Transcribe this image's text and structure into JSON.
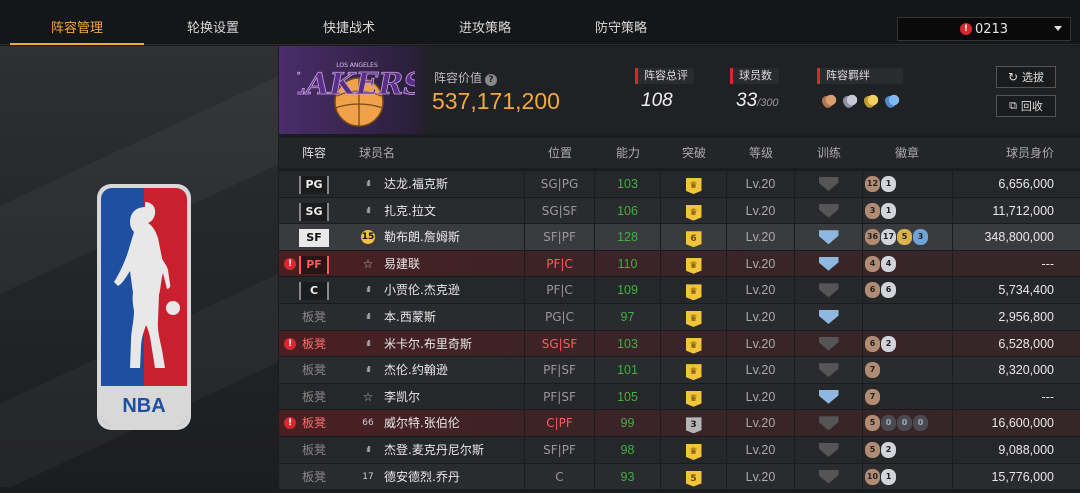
{
  "tabs": [
    {
      "label": "阵容管理",
      "active": true
    },
    {
      "label": "轮换设置",
      "active": false
    },
    {
      "label": "快捷战术",
      "active": false
    },
    {
      "label": "进攻策略",
      "active": false
    },
    {
      "label": "防守策略",
      "active": false
    }
  ],
  "roster_select": {
    "value": "0213",
    "warn_glyph": "!"
  },
  "logo": {
    "text": "NBA"
  },
  "team": {
    "name": "LAKERS",
    "city": "LOS ANGELES"
  },
  "lineup_value": {
    "label": "阵容价值",
    "help": "?",
    "value": "537,171,200"
  },
  "stats": {
    "rating": {
      "label": "阵容总评",
      "value": "108"
    },
    "players": {
      "label": "球员数",
      "value": "33",
      "max": "/300"
    },
    "bonds": {
      "label": "阵容羁绊",
      "icons": [
        "bond-bronze-icon",
        "bond-silver-icon",
        "bond-gold-icon",
        "bond-blue-icon"
      ]
    }
  },
  "buttons": {
    "select": "选拔",
    "recycle": "回收"
  },
  "columns": {
    "slot": "阵容",
    "name": "球员名",
    "position": "位置",
    "ability": "能力",
    "breakthrough": "突破",
    "level": "等级",
    "training": "训练",
    "badges": "徽章",
    "price": "球员身价"
  },
  "rows": [
    {
      "slot": "PG",
      "slot_type": "starter",
      "warn": false,
      "icon": "bars",
      "icon_text": "ıll",
      "name": "达龙.福克斯",
      "position": "SG|PG",
      "pos_warn": false,
      "ability": "103",
      "break": "♛",
      "break_grey": false,
      "level": "Lv.20",
      "train_blue": false,
      "badges": [
        [
          "12",
          "bronze"
        ],
        [
          "1",
          "silver"
        ]
      ],
      "price": "6,656,000",
      "selected": false
    },
    {
      "slot": "SG",
      "slot_type": "starter",
      "warn": false,
      "icon": "bars",
      "icon_text": "ıll",
      "name": "扎克.拉文",
      "position": "SG|SF",
      "pos_warn": false,
      "ability": "106",
      "break": "♛",
      "break_grey": false,
      "level": "Lv.20",
      "train_blue": false,
      "badges": [
        [
          "3",
          "bronze"
        ],
        [
          "1",
          "silver"
        ]
      ],
      "price": "11,712,000",
      "selected": false
    },
    {
      "slot": "SF",
      "slot_type": "selected",
      "warn": false,
      "icon": "n15",
      "icon_text": "15",
      "name": "勒布朗.詹姆斯",
      "position": "SF|PF",
      "pos_warn": false,
      "ability": "128",
      "break": "6",
      "break_grey": false,
      "level": "Lv.20",
      "train_blue": true,
      "badges": [
        [
          "36",
          "bronze"
        ],
        [
          "17",
          "silver"
        ],
        [
          "5",
          "gold"
        ],
        [
          "3",
          "blue"
        ]
      ],
      "price": "348,800,000",
      "selected": true
    },
    {
      "slot": "PF",
      "slot_type": "error",
      "warn": true,
      "icon": "star",
      "icon_text": "☆",
      "name": "易建联",
      "position": "PF|C",
      "pos_warn": true,
      "ability": "110",
      "break": "♛",
      "break_grey": false,
      "level": "Lv.20",
      "train_blue": true,
      "badges": [
        [
          "4",
          "bronze"
        ],
        [
          "4",
          "silver"
        ]
      ],
      "price": "---",
      "selected": false
    },
    {
      "slot": "C",
      "slot_type": "starter",
      "warn": false,
      "icon": "bars",
      "icon_text": "ıll",
      "name": "小贾伦.杰克逊",
      "position": "PF|C",
      "pos_warn": false,
      "ability": "109",
      "break": "♛",
      "break_grey": false,
      "level": "Lv.20",
      "train_blue": false,
      "badges": [
        [
          "6",
          "bronze"
        ],
        [
          "6",
          "silver"
        ]
      ],
      "price": "5,734,400",
      "selected": false
    },
    {
      "slot": "板凳",
      "slot_type": "bench",
      "warn": false,
      "icon": "bars",
      "icon_text": "ıll",
      "name": "本.西蒙斯",
      "position": "PG|C",
      "pos_warn": false,
      "ability": "97",
      "break": "♛",
      "break_grey": false,
      "level": "Lv.20",
      "train_blue": true,
      "badges": [],
      "price": "2,956,800",
      "selected": false
    },
    {
      "slot": "板凳",
      "slot_type": "bench-error",
      "warn": true,
      "icon": "bars",
      "icon_text": "ıll",
      "name": "米卡尔.布里奇斯",
      "position": "SG|SF",
      "pos_warn": true,
      "ability": "103",
      "break": "♛",
      "break_grey": false,
      "level": "Lv.20",
      "train_blue": false,
      "badges": [
        [
          "6",
          "bronze"
        ],
        [
          "2",
          "silver"
        ]
      ],
      "price": "6,528,000",
      "selected": false
    },
    {
      "slot": "板凳",
      "slot_type": "bench",
      "warn": false,
      "icon": "bars",
      "icon_text": "ıll",
      "name": "杰伦.约翰逊",
      "position": "PF|SF",
      "pos_warn": false,
      "ability": "101",
      "break": "♛",
      "break_grey": false,
      "level": "Lv.20",
      "train_blue": false,
      "badges": [
        [
          "7",
          "bronze"
        ]
      ],
      "price": "8,320,000",
      "selected": false
    },
    {
      "slot": "板凳",
      "slot_type": "bench",
      "warn": false,
      "icon": "star",
      "icon_text": "☆",
      "name": "李凯尔",
      "position": "PF|SF",
      "pos_warn": false,
      "ability": "105",
      "break": "♛",
      "break_grey": false,
      "level": "Lv.20",
      "train_blue": true,
      "badges": [
        [
          "7",
          "bronze"
        ]
      ],
      "price": "---",
      "selected": false
    },
    {
      "slot": "板凳",
      "slot_type": "bench-error",
      "warn": true,
      "icon": "num",
      "icon_text": "66",
      "name": "威尔特.张伯伦",
      "position": "C|PF",
      "pos_warn": true,
      "ability": "99",
      "break": "3",
      "break_grey": true,
      "level": "Lv.20",
      "train_blue": false,
      "badges": [
        [
          "5",
          "bronze"
        ],
        [
          "0",
          "dark"
        ],
        [
          "0",
          "dark"
        ],
        [
          "0",
          "dark"
        ]
      ],
      "price": "16,600,000",
      "selected": false
    },
    {
      "slot": "板凳",
      "slot_type": "bench",
      "warn": false,
      "icon": "bars",
      "icon_text": "ıll",
      "name": "杰登.麦克丹尼尔斯",
      "position": "SF|PF",
      "pos_warn": false,
      "ability": "98",
      "break": "♛",
      "break_grey": false,
      "level": "Lv.20",
      "train_blue": false,
      "badges": [
        [
          "5",
          "bronze"
        ],
        [
          "2",
          "silver"
        ]
      ],
      "price": "9,088,000",
      "selected": false
    },
    {
      "slot": "板凳",
      "slot_type": "bench",
      "warn": false,
      "icon": "num",
      "icon_text": "17",
      "name": "德安德烈.乔丹",
      "position": "C",
      "pos_warn": false,
      "ability": "93",
      "break": "5",
      "break_grey": false,
      "level": "Lv.20",
      "train_blue": false,
      "badges": [
        [
          "10",
          "bronze"
        ],
        [
          "1",
          "silver"
        ]
      ],
      "price": "15,776,000",
      "selected": false
    }
  ]
}
